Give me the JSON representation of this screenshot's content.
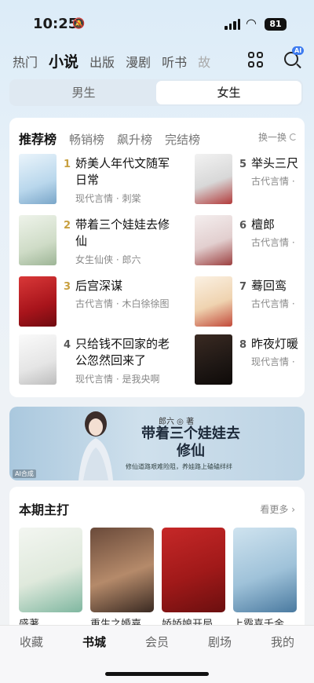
{
  "status_bar": {
    "time": "10:25",
    "battery": "81"
  },
  "top_nav": {
    "tabs": [
      "热门",
      "小说",
      "出版",
      "漫剧",
      "听书",
      "故"
    ],
    "active_index": 1,
    "ai_badge": "AI"
  },
  "gender": {
    "options": [
      "男生",
      "女生"
    ],
    "selected": "女生"
  },
  "ranking": {
    "tabs": [
      "推荐榜",
      "畅销榜",
      "飙升榜",
      "完结榜"
    ],
    "refresh_label": "换一换",
    "items": [
      {
        "rank": "1",
        "title": "娇美人年代文随军日常",
        "meta": "现代言情 · 刺棠"
      },
      {
        "rank": "2",
        "title": "带着三个娃娃去修仙",
        "meta": "女生仙侠 · 郎六"
      },
      {
        "rank": "3",
        "title": "后宫深谋",
        "meta": "古代言情 · 木白徐徐图"
      },
      {
        "rank": "4",
        "title": "只给钱不回家的老公忽然回来了",
        "meta": "现代言情 · 是我央啊"
      },
      {
        "rank": "5",
        "title": "举头三尺",
        "meta": "古代言情 ·"
      },
      {
        "rank": "6",
        "title": "檀郎",
        "meta": "古代言情 ·"
      },
      {
        "rank": "7",
        "title": "蓦回鸾",
        "meta": "古代言情 ·"
      },
      {
        "rank": "8",
        "title": "昨夜灯暖",
        "meta": "现代言情 ·"
      }
    ]
  },
  "banner": {
    "author": "郎六 ◎ 著",
    "title": "带着三个娃娃去修仙",
    "subtitle": "修仙道路艰难险阻，养娃路上磕磕绊绊",
    "ai_tag": "AI合成"
  },
  "featured": {
    "title": "本期主打",
    "more_label": "看更多",
    "captions": [
      "盛著",
      "重生之婚嘉",
      "娇娇娘开局",
      "上霸喜千金"
    ]
  },
  "tab_bar": {
    "items": [
      "收藏",
      "书城",
      "会员",
      "剧场",
      "我的"
    ],
    "active_index": 1
  },
  "colors": {
    "rank_top3": "#c8a040",
    "banner_bg": "#bcd3e4",
    "accent_ai": "#3d7bf0"
  }
}
